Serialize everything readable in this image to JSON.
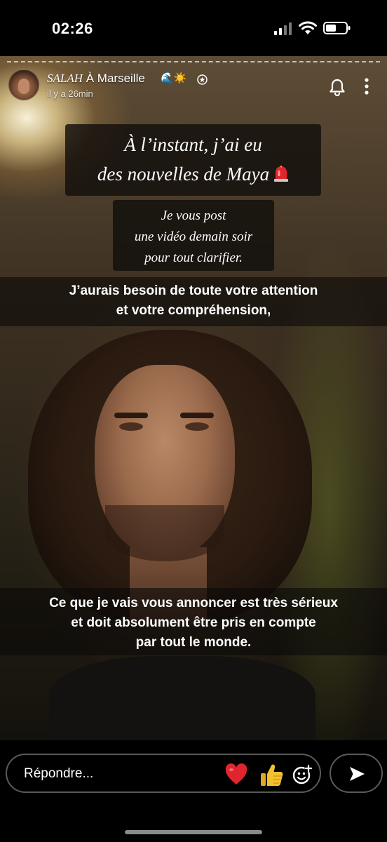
{
  "status_bar": {
    "time": "02:26"
  },
  "story": {
    "user_name": "SALAH",
    "location": "À Marseille",
    "header_emojis": "🌊☀️",
    "timestamp": "il y a 26min",
    "caption_serif_1": [
      "À l’instant, j’ai eu",
      "des nouvelles de Maya"
    ],
    "caption_serif_2": [
      "Je vous post",
      "une vidéo demain soir",
      "pour tout clarifier."
    ],
    "caption_band_1": [
      "J’aurais besoin de toute votre attention",
      "et votre compréhension,"
    ],
    "caption_band_2": [
      "Ce que je vais vous annoncer est très sérieux",
      "et doit absolument être pris en compte",
      "par tout le monde."
    ]
  },
  "reply": {
    "placeholder": "Répondre..."
  },
  "icons": {
    "signal": "signal-icon",
    "wifi": "wifi-icon",
    "battery": "battery-icon",
    "bell": "bell-icon",
    "more": "more-icon",
    "siren": "siren-icon",
    "heart": "heart-icon",
    "thumbs": "thumbs-up-icon",
    "emoji_add": "emoji-add-icon",
    "send": "send-icon"
  },
  "colors": {
    "heart": "#e0252f",
    "thumbs": "#f2c12e",
    "caption_band": "#0c0a08"
  }
}
